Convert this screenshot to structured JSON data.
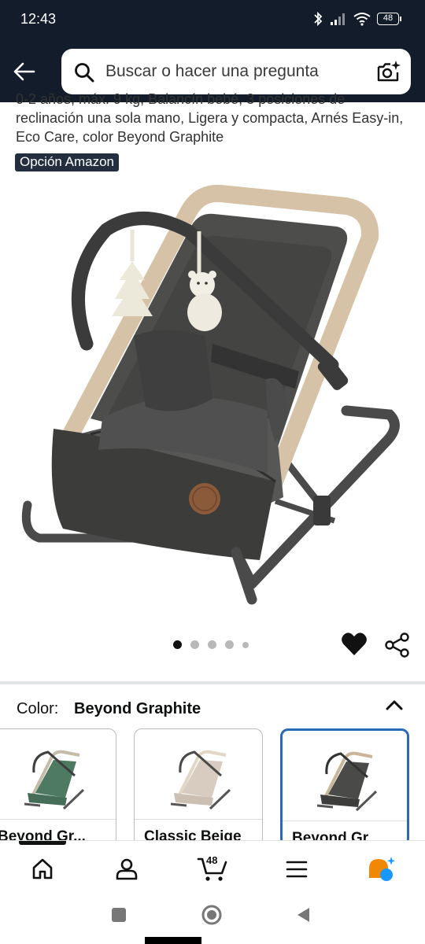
{
  "status_bar": {
    "time": "12:43",
    "battery": "48",
    "icons": [
      "bluetooth-icon",
      "signal-icon",
      "wifi-icon",
      "battery-icon"
    ]
  },
  "search": {
    "placeholder": "Buscar o hacer una pregunta",
    "back_icon": "arrow-left-icon",
    "search_icon": "magnifier-icon",
    "camera_icon": "camera-sparkle-icon"
  },
  "product": {
    "title": "0-2 años, máx. 9 kg, Balancín bebé, 3 posiciones de reclinación una sola mano, Ligera y compacta, Arnés Easy-in, Eco Care, color Beyond Graphite",
    "badge": "Opción Amazon",
    "carousel": {
      "count": 5,
      "active_index": 0
    },
    "actions": [
      "heart-icon",
      "share-icon"
    ]
  },
  "color_selector": {
    "label": "Color:",
    "selected": "Beyond Graphite",
    "options": [
      {
        "label": "Beyond Gr...",
        "fabric": "#4f7a62",
        "frame": "#c4bca8",
        "selected": false
      },
      {
        "label": "Classic Beige",
        "fabric": "#d8cbbf",
        "frame": "#e2d6c6",
        "selected": false
      },
      {
        "label": "Beyond Gr...",
        "fabric": "#4a4a48",
        "frame": "#c8b59a",
        "selected": true
      }
    ]
  },
  "bottom_nav": {
    "items": [
      "home-icon",
      "account-icon",
      "cart-icon",
      "menu-icon",
      "rufus-icon"
    ],
    "cart_count": "48",
    "active": "home"
  },
  "system_nav": [
    "recents-button",
    "home-button",
    "back-button"
  ],
  "colors": {
    "header_bg": "#131c2a",
    "badge_bg": "#232f3e",
    "selected_border": "#2a6bb5",
    "rufus_orange": "#f08804",
    "rufus_blue": "#1a98ff"
  }
}
